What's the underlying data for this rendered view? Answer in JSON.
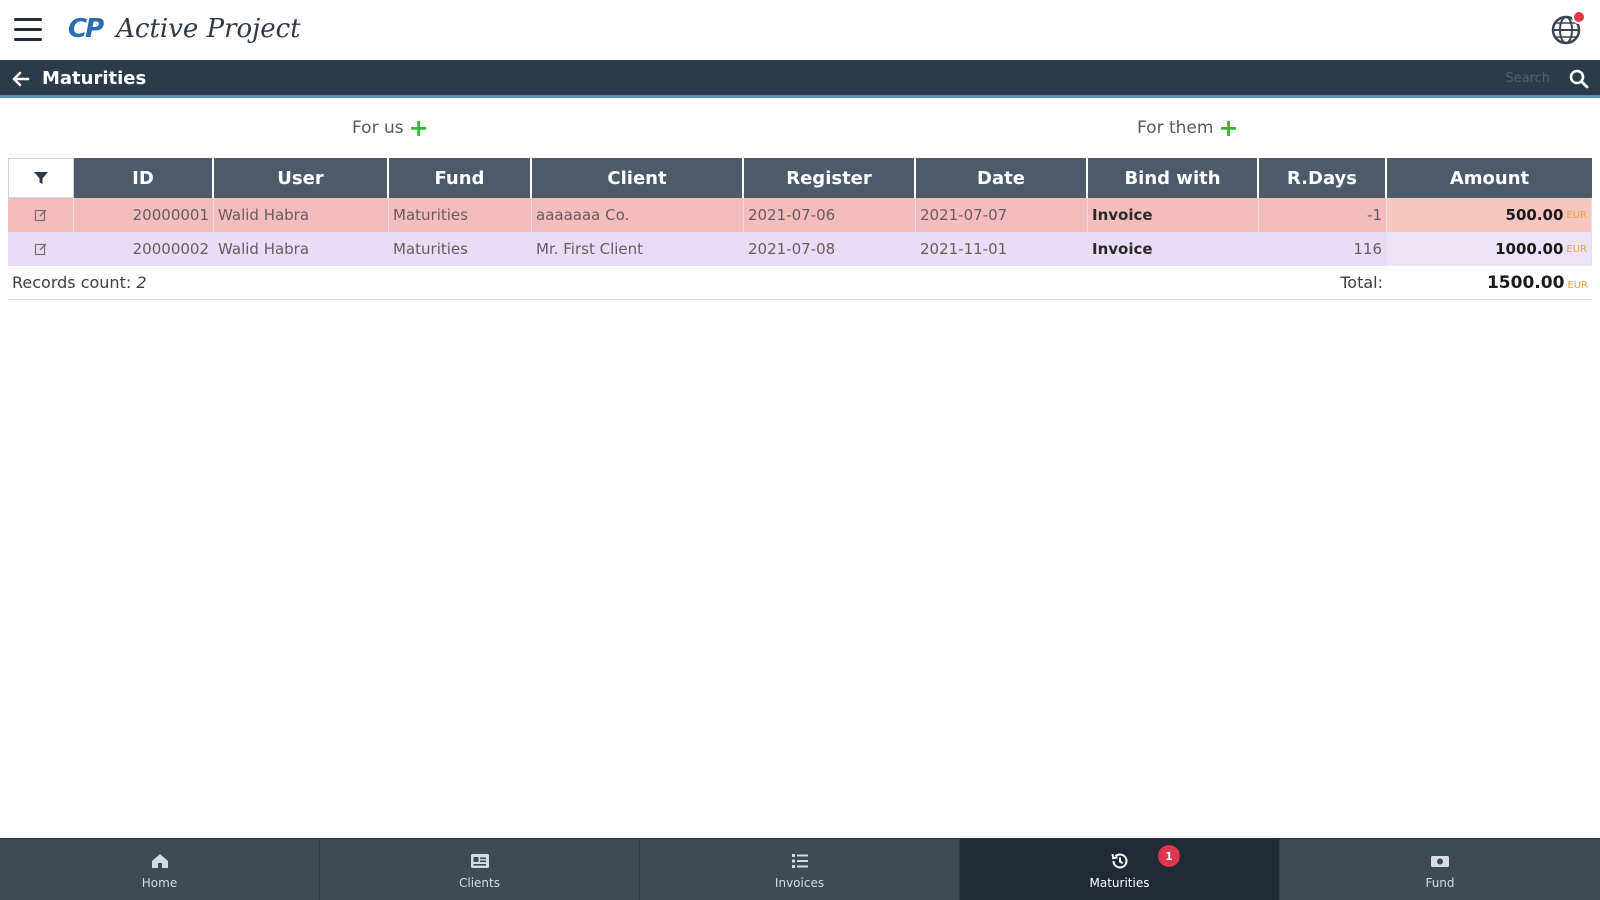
{
  "app": {
    "logo_mark": "CP",
    "logo_text": "Active Project"
  },
  "titlebar": {
    "title": "Maturities",
    "search_placeholder": "Search"
  },
  "actions": {
    "for_us": "For us",
    "for_them": "For them"
  },
  "table": {
    "columns": [
      "ID",
      "User",
      "Fund",
      "Client",
      "Register",
      "Date",
      "Bind with",
      "R.Days",
      "Amount"
    ],
    "rows": [
      {
        "id": "20000001",
        "user": "Walid Habra",
        "fund": "Maturities",
        "client": "aaaaaaa Co.",
        "register": "2021-07-06",
        "date": "2021-07-07",
        "bind": "Invoice",
        "rdays": "-1",
        "amount": "500.00",
        "currency": "EUR"
      },
      {
        "id": "20000002",
        "user": "Walid Habra",
        "fund": "Maturities",
        "client": "Mr. First Client",
        "register": "2021-07-08",
        "date": "2021-11-01",
        "bind": "Invoice",
        "rdays": "116",
        "amount": "1000.00",
        "currency": "EUR"
      }
    ],
    "records_count_label": "Records count:",
    "records_count": "2",
    "total_label": "Total:",
    "total_value": "1500.00",
    "total_currency": "EUR"
  },
  "bottom_nav": {
    "items": [
      {
        "label": "Home",
        "icon": "home-icon"
      },
      {
        "label": "Clients",
        "icon": "clients-icon"
      },
      {
        "label": "Invoices",
        "icon": "invoices-icon"
      },
      {
        "label": "Maturities",
        "icon": "history-icon",
        "badge": "1"
      },
      {
        "label": "Fund",
        "icon": "fund-icon"
      }
    ]
  },
  "colors": {
    "header_bg": "#2c3b49",
    "column_header_bg": "#4d5b68",
    "row1_bg": "#f4bcbc",
    "row2_bg": "#e8dcf6",
    "add_plus": "#2bbd35",
    "currency": "#e8a63a",
    "badge": "#e0354a"
  }
}
